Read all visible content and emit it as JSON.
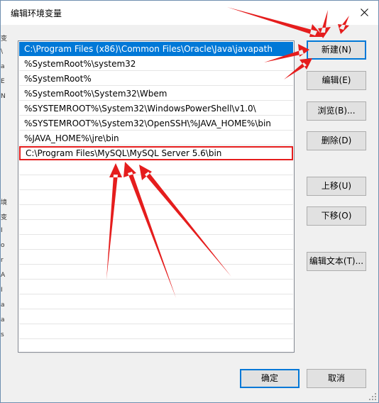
{
  "window": {
    "title": "编辑环境变量",
    "close_glyph": "✕"
  },
  "behind_strip": [
    "变",
    "\\",
    "a",
    "E",
    "N",
    "",
    "",
    "",
    "",
    "",
    "",
    "境",
    "变",
    "I",
    "o",
    "r",
    "A",
    "I",
    "a",
    "a",
    "s"
  ],
  "paths": [
    "C:\\Program Files (x86)\\Common Files\\Oracle\\Java\\javapath",
    "%SystemRoot%\\system32",
    "%SystemRoot%",
    "%SystemRoot%\\System32\\Wbem",
    "%SYSTEMROOT%\\System32\\WindowsPowerShell\\v1.0\\",
    "%SYSTEMROOT%\\System32\\OpenSSH\\%JAVA_HOME%\\bin",
    "%JAVA_HOME%\\jre\\bin",
    "C:\\Program Files\\MySQL\\MySQL Server 5.6\\bin"
  ],
  "selected_index": 0,
  "editing_index": 7,
  "buttons": {
    "new": "新建(N)",
    "edit": "编辑(E)",
    "browse": "浏览(B)...",
    "delete": "删除(D)",
    "move_up": "上移(U)",
    "move_down": "下移(O)",
    "edit_text": "编辑文本(T)...",
    "ok": "确定",
    "cancel": "取消"
  },
  "colors": {
    "selection": "#0078d7",
    "annotation_arrow": "#e51d1d",
    "primary_border": "#0078d7"
  }
}
